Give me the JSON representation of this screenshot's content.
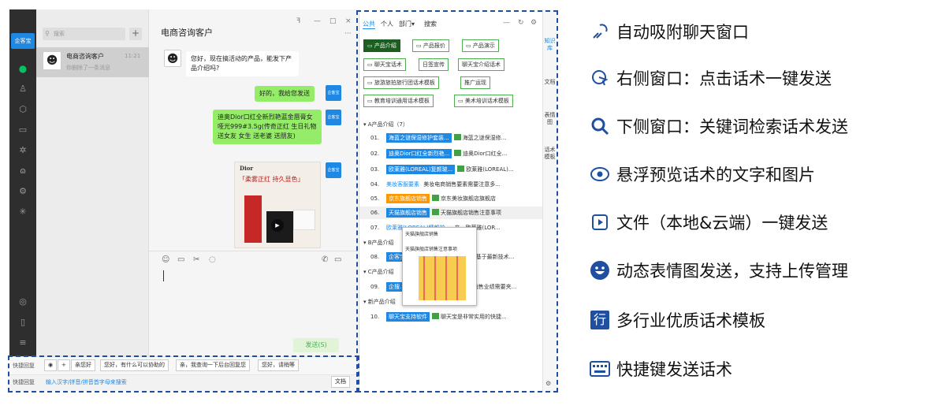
{
  "app": {
    "brand": "企客宝",
    "search_placeholder": "搜索",
    "plus": "+",
    "chat_item": {
      "name": "电商咨询客户",
      "time": "11:21",
      "preview": "你删除了一条消息"
    },
    "chat_title": "电商咨询客户",
    "window_buttons": [
      "ꟻ",
      "—",
      "□",
      "×"
    ],
    "more": "···",
    "messages": [
      {
        "side": "left",
        "text": "您好，现在搞活动的产品，能发下产品介绍吗?"
      },
      {
        "side": "right",
        "text": "好的，我给您发送",
        "tag": "企客宝"
      },
      {
        "side": "right",
        "text": "迪奥Dior口红全新烈艳蓝金唇膏女哑光999#3.5g(传奇正红 生日礼物送女友 女生 送老婆 送朋友)",
        "tag": "企客宝"
      },
      {
        "side": "right",
        "image": true,
        "tag": "企客宝"
      }
    ],
    "ad": {
      "brand": "Dior",
      "slogan": "「柔雾正红 持久显色」"
    },
    "send_label": "发送(S)",
    "quick_bar_label": "快捷回复",
    "quick_buttons": [
      "亲您好",
      "您好，有什么可以协助的",
      "亲，我查询一下后台回复您",
      "您好，请稍等"
    ],
    "keyword_label": "快捷回复",
    "keyword_placeholder": "输入汉字/拼音/拼音首字母来搜索",
    "doc_button": "文档"
  },
  "panel": {
    "tabs": [
      "公共",
      "个人",
      "部门▾",
      "搜索"
    ],
    "folders": [
      [
        "产品介绍",
        "产品报价",
        "产品演示"
      ],
      [
        "聊天宝话术",
        "日签宣传",
        "聊天宝介绍话术"
      ],
      [
        "旅游旅拍旅行团话术模板",
        "推广运现"
      ],
      [
        "教育培训通用话术模板",
        "美术培训话术模板"
      ]
    ],
    "side_tabs": [
      "知识库",
      "文档",
      "表情图",
      "话术模板"
    ],
    "groups": [
      {
        "label": "▾ A产品介绍（7）",
        "rows": [
          {
            "num": "01.",
            "pill": "海蓝之谜保湿修护套装...",
            "color": "#1e88e5",
            "title": "海蓝之谜保湿修..."
          },
          {
            "num": "02.",
            "pill": "迪奥Dior口红全新烈艳...",
            "color": "#1e88e5",
            "title": "迪奥Dior口红全..."
          },
          {
            "num": "03.",
            "pill": "欧莱雅(LOREAL)复颜玻...",
            "color": "#1e88e5",
            "title": "欧莱雅(LOREAL)..."
          },
          {
            "num": "04.",
            "pill": "美妆客服要素",
            "color": "none",
            "title": "美妆电商销售要素需要注意多..."
          },
          {
            "num": "05.",
            "pill": "京东旗舰店销售",
            "color": "#ff9800",
            "title": "京东美妆旗舰店旗舰店"
          },
          {
            "num": "06.",
            "pill": "天猫旗舰店销售",
            "color": "#1e88e5",
            "title": "天猫旗舰店销售注意事项"
          },
          {
            "num": "07.",
            "pill": "欧莱雅(LOREAL)精颜护...",
            "color": "none",
            "title": "亲，欧莱雅(LOR..."
          }
        ]
      },
      {
        "label": "▾ B产品介绍",
        "rows": [
          {
            "num": "08.",
            "pill": "企客宝...",
            "color": "#1e88e5",
            "title": "是基于最新技术..."
          }
        ]
      },
      {
        "label": "▾ C产品介绍",
        "rows": [
          {
            "num": "09.",
            "pill": "企搜...",
            "color": "#1e88e5",
            "title": "销售业绩需要夹..."
          }
        ]
      },
      {
        "label": "▾ 新产品介绍",
        "rows": [
          {
            "num": "10.",
            "pill": "聊天宝支持软件",
            "color": "#1e88e5",
            "title": "聊天宝是非常实用的快捷..."
          }
        ]
      }
    ],
    "popup": {
      "title": "天猫旗舰店销售",
      "subtitle": "天猫旗舰店销售注意事项"
    }
  },
  "features": [
    {
      "icon": "magnet-icon",
      "text": "自动吸附聊天窗口"
    },
    {
      "icon": "click-icon",
      "text": "右侧窗口：点击话术一键发送"
    },
    {
      "icon": "search-icon",
      "text": "下侧窗口：关键词检索话术发送"
    },
    {
      "icon": "eye-icon",
      "text": "悬浮预览话术的文字和图片"
    },
    {
      "icon": "play-file-icon",
      "text": "文件（本地&云端）一键发送"
    },
    {
      "icon": "smiley-icon",
      "text": "动态表情图发送，支持上传管理"
    },
    {
      "icon": "row-icon",
      "text": "多行业优质话术模板",
      "glyph": "行"
    },
    {
      "icon": "keyboard-icon",
      "text": "快捷键发送话术"
    }
  ],
  "colors": {
    "accent": "#1e4fa0",
    "green": "#4caf50",
    "blue": "#1e88e5"
  }
}
